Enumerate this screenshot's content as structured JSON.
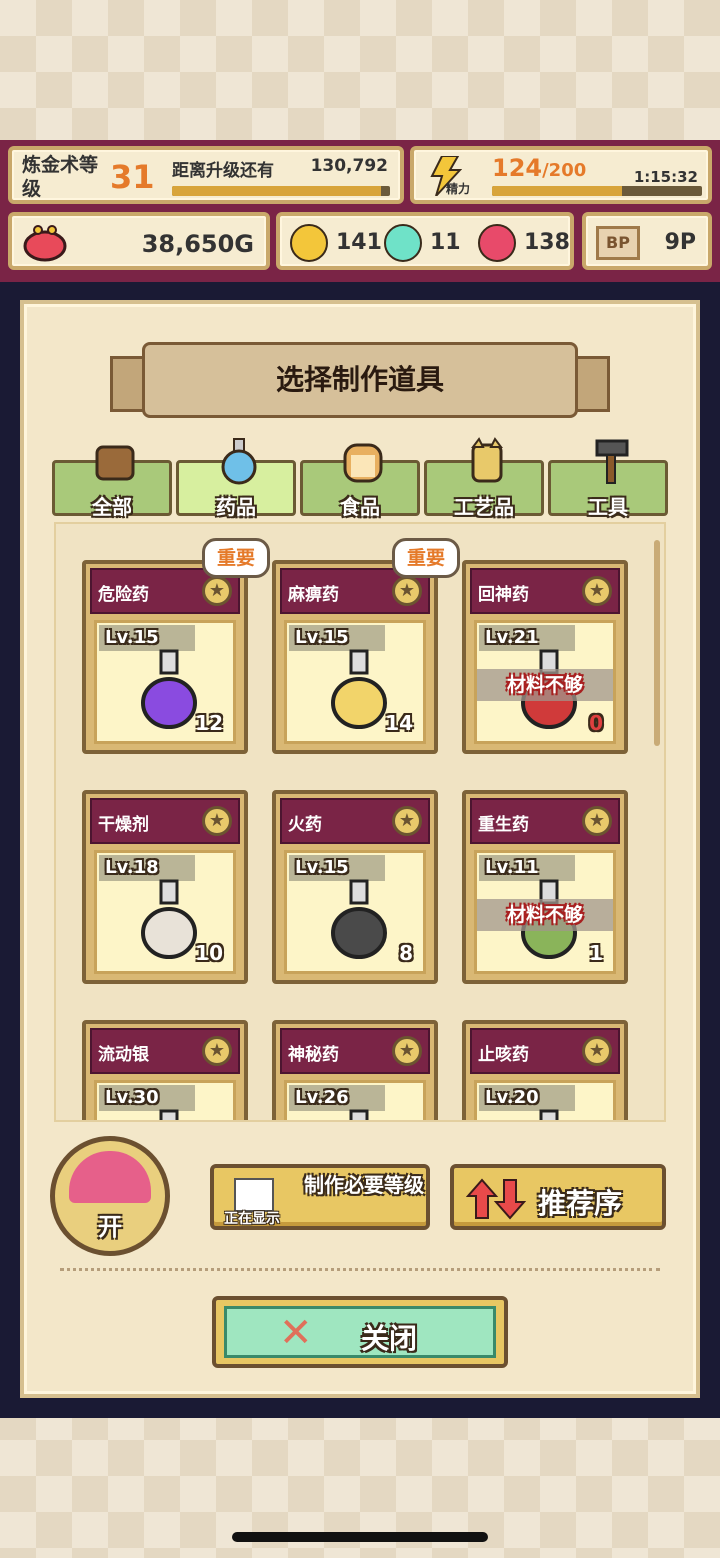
{
  "header": {
    "level_title": "炼金术等级",
    "level": "31",
    "next_label": "距离升级还有",
    "next_exp": "130,792",
    "exp_progress": 0.96,
    "energy_icon_label": "精力",
    "energy_current": "124",
    "energy_max": "/200",
    "energy_progress": 0.62,
    "energy_timer": "1:15:32",
    "gold": "38,650G",
    "orb_yellow": "141",
    "orb_cyan": "11",
    "orb_pink": "138",
    "bp_icon": "BP",
    "bp": "9P",
    "colors": {
      "yellow": "#f3c63a",
      "cyan": "#6fe2c8",
      "pink": "#e84a6a"
    }
  },
  "dialog": {
    "title": "选择制作道具",
    "tabs": [
      "全部",
      "药品",
      "食品",
      "工艺品",
      "工具"
    ],
    "active_tab": 1,
    "items": [
      {
        "name": "危险药",
        "level": "Lv.15",
        "count": "12",
        "important": "重要",
        "shortage": "",
        "color": "#8a4be0"
      },
      {
        "name": "麻痹药",
        "level": "Lv.15",
        "count": "14",
        "important": "重要",
        "shortage": "",
        "color": "#f2d46a"
      },
      {
        "name": "回神药",
        "level": "Lv.21",
        "count": "0",
        "important": "",
        "shortage": "材料不够",
        "color": "#d03a3a"
      },
      {
        "name": "干燥剂",
        "level": "Lv.18",
        "count": "10",
        "important": "",
        "shortage": "",
        "color": "#e8e2d8"
      },
      {
        "name": "火药",
        "level": "Lv.15",
        "count": "8",
        "important": "",
        "shortage": "",
        "color": "#4a4a4a"
      },
      {
        "name": "重生药",
        "level": "Lv.11",
        "count": "1",
        "important": "",
        "shortage": "材料不够",
        "color": "#8ab45a"
      },
      {
        "name": "流动银",
        "level": "Lv.30",
        "count": "",
        "important": "",
        "shortage": "",
        "color": "#cfcfd8"
      },
      {
        "name": "神秘药",
        "level": "Lv.26",
        "count": "",
        "important": "",
        "shortage": "",
        "color": "#5a5a5a"
      },
      {
        "name": "止咳药",
        "level": "Lv.20",
        "count": "",
        "important": "",
        "shortage": "",
        "color": "#8a8a8a"
      }
    ],
    "open_label": "开",
    "sort_status": "正在显示",
    "sort_label": "制作必要等级",
    "order_label": "推荐序",
    "close_label": "关闭"
  }
}
